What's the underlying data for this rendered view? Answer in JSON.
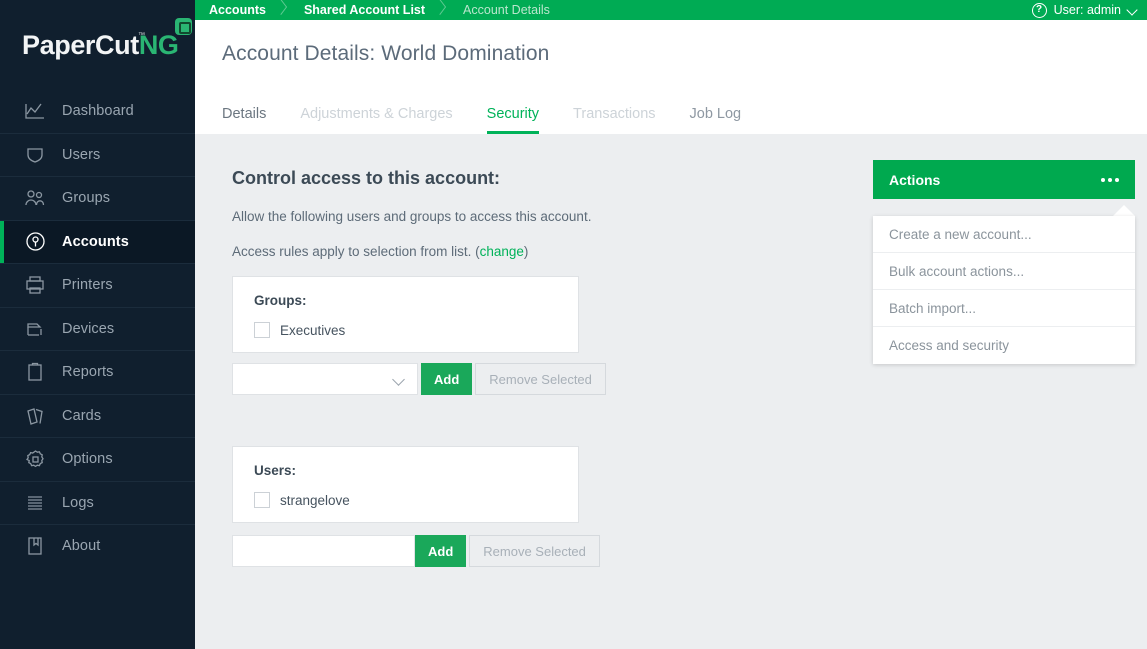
{
  "brand": {
    "name_primary": "PaperCut",
    "name_secondary": "NG",
    "trademark": "™",
    "badge_icon": "papercut-logo-badge"
  },
  "sidebar": {
    "items": [
      {
        "label": "Dashboard",
        "icon": "chart-line-icon",
        "active": false
      },
      {
        "label": "Users",
        "icon": "user-shield-icon",
        "active": false
      },
      {
        "label": "Groups",
        "icon": "people-group-icon",
        "active": false
      },
      {
        "label": "Accounts",
        "icon": "account-key-icon",
        "active": true
      },
      {
        "label": "Printers",
        "icon": "printer-icon",
        "active": false
      },
      {
        "label": "Devices",
        "icon": "device-copier-icon",
        "active": false
      },
      {
        "label": "Reports",
        "icon": "clipboard-icon",
        "active": false
      },
      {
        "label": "Cards",
        "icon": "cards-icon",
        "active": false
      },
      {
        "label": "Options",
        "icon": "gear-icon",
        "active": false
      },
      {
        "label": "Logs",
        "icon": "list-lines-icon",
        "active": false
      },
      {
        "label": "About",
        "icon": "book-bookmark-icon",
        "active": false
      }
    ]
  },
  "topbar": {
    "breadcrumbs": [
      {
        "label": "Accounts",
        "current": false
      },
      {
        "label": "Shared Account List",
        "current": false
      },
      {
        "label": "Account Details",
        "current": true
      }
    ],
    "help_icon": "help-circle-icon",
    "help_glyph": "?",
    "user_label": "User: admin",
    "user_chevron_icon": "chevron-down-icon"
  },
  "page": {
    "title": "Account Details: World Domination",
    "tabs": [
      {
        "label": "Details",
        "state": "strong"
      },
      {
        "label": "Adjustments & Charges",
        "state": "dim"
      },
      {
        "label": "Security",
        "state": "active"
      },
      {
        "label": "Transactions",
        "state": "dim"
      },
      {
        "label": "Job Log",
        "state": "mid"
      }
    ]
  },
  "security": {
    "section_title": "Control access to this account:",
    "description": "Allow the following users and groups to access this account.",
    "rule_text_before": "Access rules apply to selection from list. (",
    "rule_link": "change",
    "rule_text_after": ")",
    "groups_panel": {
      "label": "Groups:",
      "items": [
        {
          "label": "Executives",
          "checked": false
        }
      ],
      "select_value": "",
      "add_label": "Add",
      "remove_label": "Remove Selected"
    },
    "users_panel": {
      "label": "Users:",
      "items": [
        {
          "label": "strangelove",
          "checked": false
        }
      ],
      "input_value": "",
      "add_label": "Add",
      "remove_label": "Remove Selected"
    }
  },
  "actions": {
    "button_label": "Actions",
    "more_icon": "ellipsis-icon",
    "menu_items": [
      "Create a new account...",
      "Bulk account actions...",
      "Batch import...",
      "Access and security"
    ]
  },
  "colors": {
    "brand_green": "#00ab54",
    "accent_green": "#00b259",
    "button_green": "#1aa85a",
    "sidebar_navy": "#101f2e",
    "content_gray": "#eceef0"
  }
}
